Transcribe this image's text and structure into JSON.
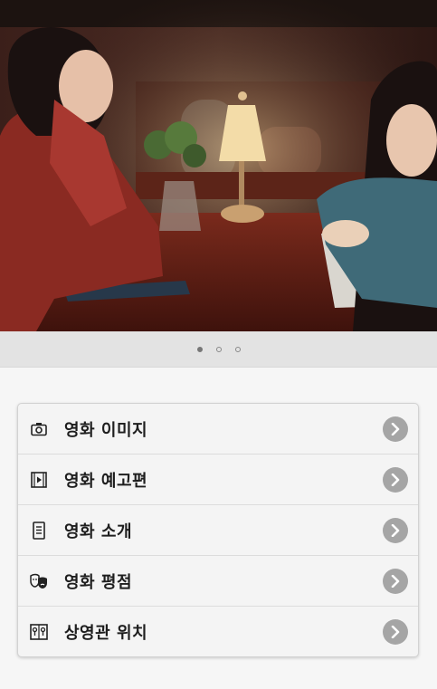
{
  "hero": {
    "pages": 3,
    "active_page": 1
  },
  "menu": {
    "items": [
      {
        "label": "영화 이미지",
        "icon": "camera-icon"
      },
      {
        "label": "영화 예고편",
        "icon": "film-play-icon"
      },
      {
        "label": "영화 소개",
        "icon": "document-icon"
      },
      {
        "label": "영화 평점",
        "icon": "theater-masks-icon"
      },
      {
        "label": "상영관 위치",
        "icon": "building-location-icon"
      }
    ]
  },
  "colors": {
    "arrow_bg": "#a5a5a5",
    "label_text": "#1e1e1e",
    "pager_bg": "#e3e3e3"
  }
}
